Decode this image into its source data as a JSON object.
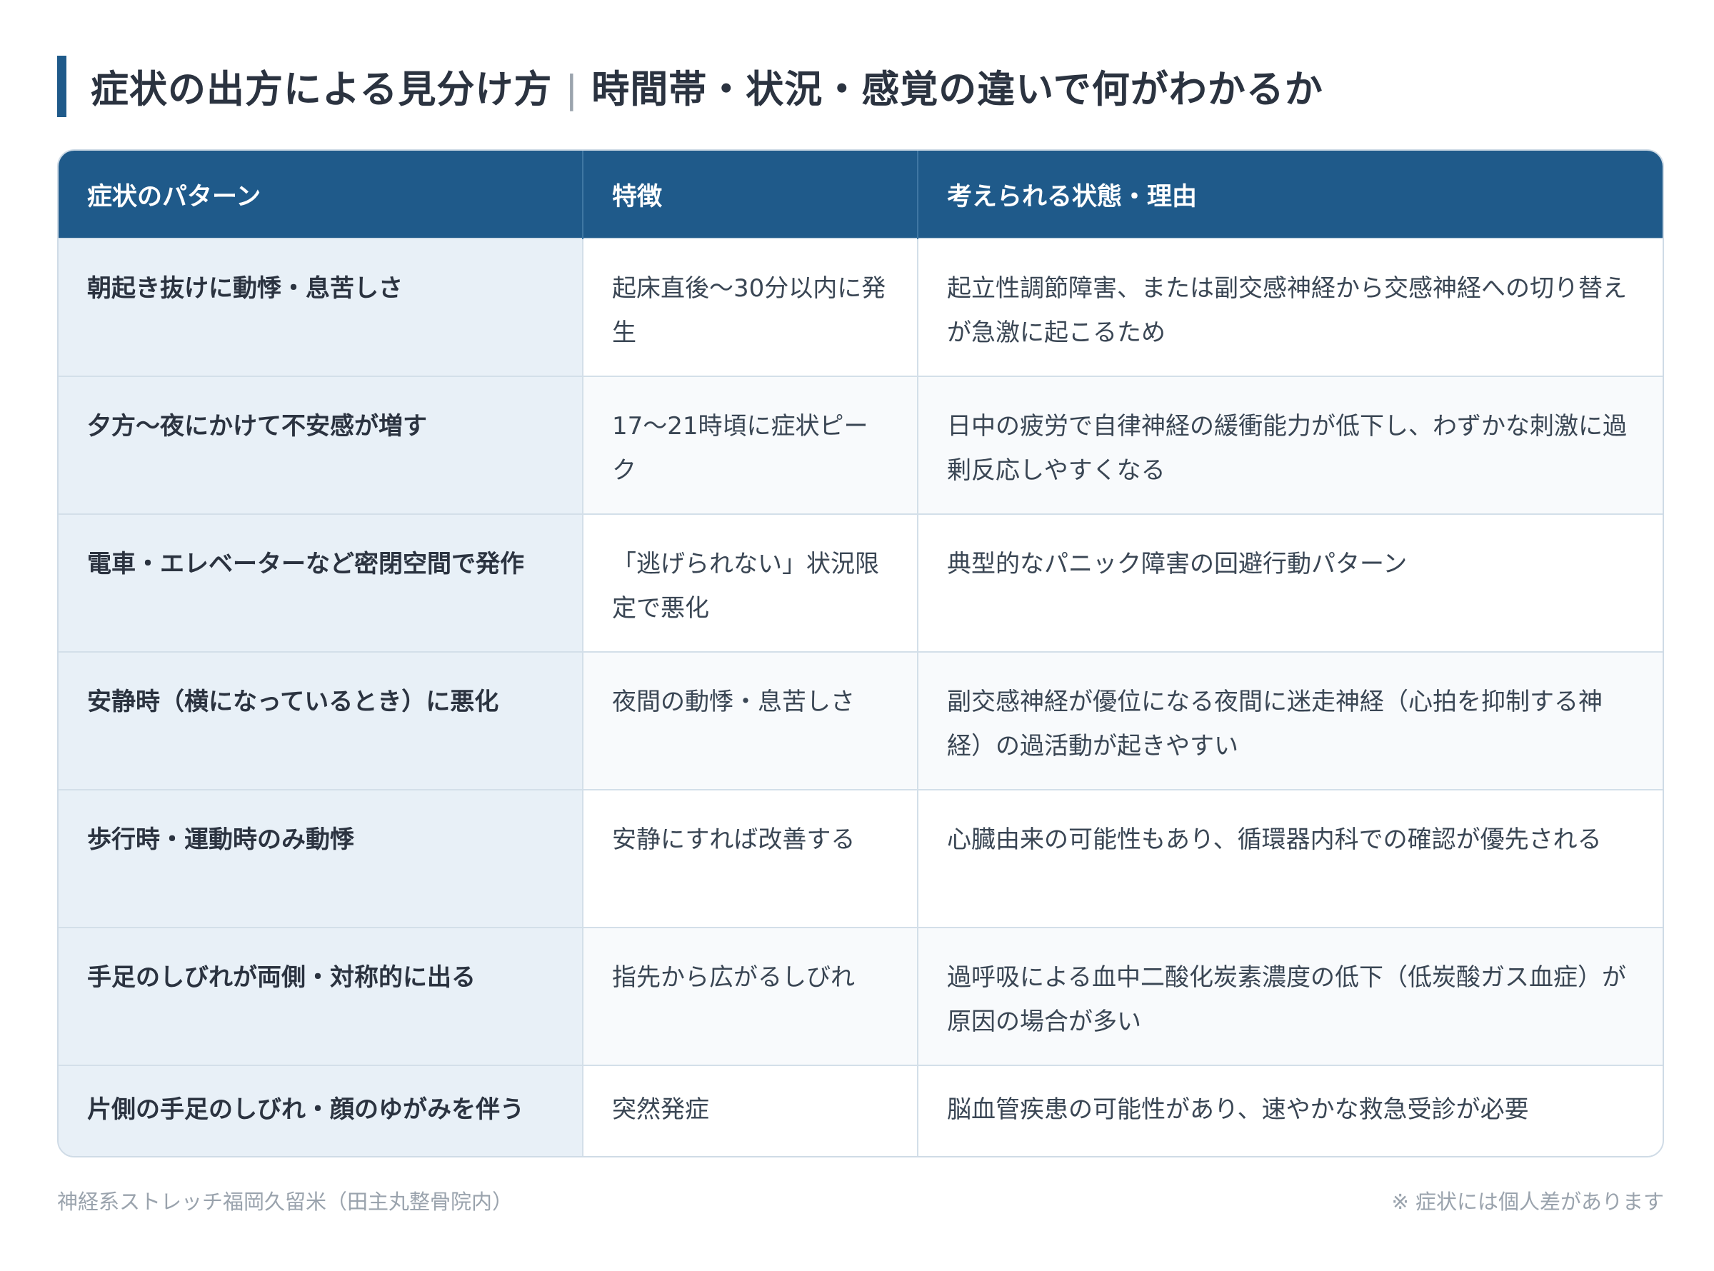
{
  "title": {
    "main": "症状の出方による見分け方",
    "separator": "|",
    "sub": "時間帯・状況・感覚の違いで何がわかるか"
  },
  "table": {
    "headers": [
      "症状のパターン",
      "特徴",
      "考えられる状態・理由"
    ],
    "rows": [
      {
        "pattern": "朝起き抜けに動悸・息苦しさ",
        "feature": "起床直後〜30分以内に発生",
        "reason": "起立性調節障害、または副交感神経から交感神経への切り替えが急激に起こるため"
      },
      {
        "pattern": "夕方〜夜にかけて不安感が増す",
        "feature": "17〜21時頃に症状ピーク",
        "reason": "日中の疲労で自律神経の緩衝能力が低下し、わずかな刺激に過剰反応しやすくなる"
      },
      {
        "pattern": "電車・エレベーターなど密閉空間で発作",
        "feature": "「逃げられない」状況限定で悪化",
        "reason": "典型的なパニック障害の回避行動パターン"
      },
      {
        "pattern": "安静時（横になっているとき）に悪化",
        "feature": "夜間の動悸・息苦しさ",
        "reason": "副交感神経が優位になる夜間に迷走神経（心拍を抑制する神経）の過活動が起きやすい"
      },
      {
        "pattern": "歩行時・運動時のみ動悸",
        "feature": "安静にすれば改善する",
        "reason": "心臓由来の可能性もあり、循環器内科での確認が優先される"
      },
      {
        "pattern": "手足のしびれが両側・対称的に出る",
        "feature": "指先から広がるしびれ",
        "reason": "過呼吸による血中二酸化炭素濃度の低下（低炭酸ガス血症）が原因の場合が多い"
      },
      {
        "pattern": "片側の手足のしびれ・顔のゆがみを伴う",
        "feature": "突然発症",
        "reason": "脳血管疾患の可能性があり、速やかな救急受診が必要"
      }
    ]
  },
  "footer": {
    "source": "神経系ストレッチ福岡久留米（田主丸整骨院内）",
    "note": "※ 症状には個人差があります"
  },
  "colors": {
    "accent": "#1f5a8a",
    "pattern_cell_bg": "#e8f0f7",
    "border": "#d3dfe9"
  }
}
